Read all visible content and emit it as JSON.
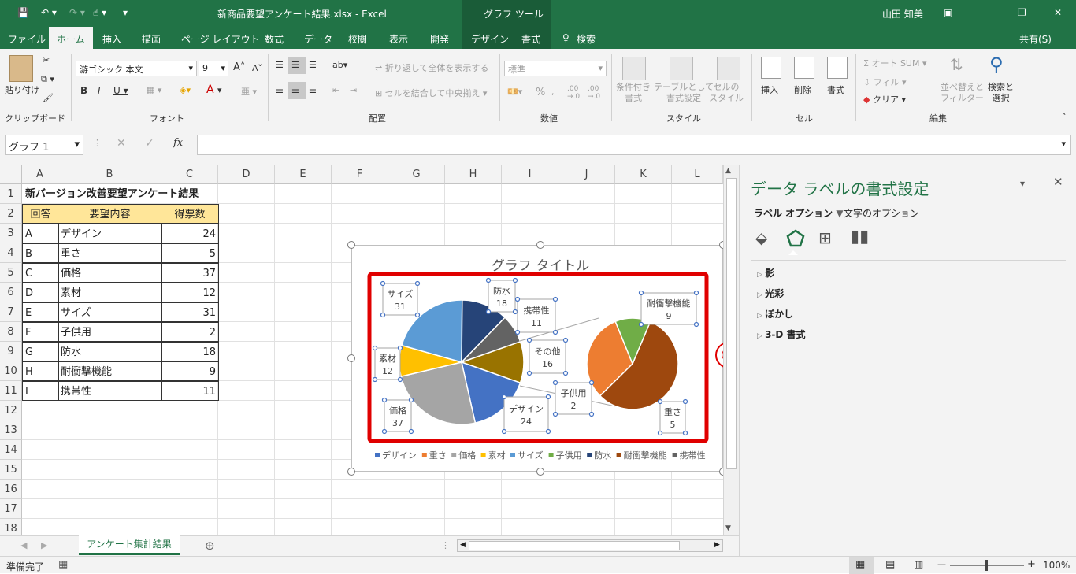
{
  "window": {
    "title": "新商品要望アンケート結果.xlsx  -  Excel",
    "context_tool": "グラフ ツール",
    "user": "山田 知美"
  },
  "tabs": [
    "ファイル",
    "ホーム",
    "挿入",
    "描画",
    "ページ レイアウト",
    "数式",
    "データ",
    "校閲",
    "表示",
    "開発",
    "デザイン",
    "書式"
  ],
  "search_label": "検索",
  "share_label": "共有(S)",
  "ribbon": {
    "clipboard": {
      "paste": "貼り付け",
      "label": "クリップボード"
    },
    "font": {
      "name": "游ゴシック 本文",
      "size": "9",
      "label": "フォント"
    },
    "alignment": {
      "wrap": "折り返して全体を表示する",
      "merge": "セルを結合して中央揃え",
      "label": "配置"
    },
    "number": {
      "format": "標準",
      "label": "数値"
    },
    "styles": {
      "conditional": "条件付き\n書式",
      "table": "テーブルとして\n書式設定",
      "cell": "セルの\nスタイル",
      "label": "スタイル"
    },
    "cells": {
      "insert": "挿入",
      "delete": "削除",
      "format": "書式",
      "label": "セル"
    },
    "editing": {
      "autosum": "オート SUM",
      "fill": "フィル",
      "clear": "クリア",
      "sort": "並べ替えと\nフィルター",
      "find": "検索と\n選択",
      "label": "編集"
    }
  },
  "formula_bar": {
    "name_box": "グラフ 1",
    "fx": "fx",
    "value": ""
  },
  "sheet": {
    "columns": [
      "A",
      "B",
      "C",
      "D",
      "E",
      "F",
      "G",
      "H",
      "I",
      "J",
      "K",
      "L"
    ],
    "rows": [
      "1",
      "2",
      "3",
      "4",
      "5",
      "6",
      "7",
      "8",
      "9",
      "10",
      "11",
      "12",
      "13",
      "14",
      "15",
      "16",
      "17",
      "18"
    ],
    "title": "新バージョン改善要望アンケート結果",
    "headers": [
      "回答",
      "要望内容",
      "得票数"
    ],
    "data": [
      [
        "A",
        "デザイン",
        "24"
      ],
      [
        "B",
        "重さ",
        "5"
      ],
      [
        "C",
        "価格",
        "37"
      ],
      [
        "D",
        "素材",
        "12"
      ],
      [
        "E",
        "サイズ",
        "31"
      ],
      [
        "F",
        "子供用",
        "2"
      ],
      [
        "G",
        "防水",
        "18"
      ],
      [
        "H",
        "耐衝撃機能",
        "9"
      ],
      [
        "I",
        "携帯性",
        "11"
      ]
    ],
    "tab_name": "アンケート集計結果"
  },
  "chart_data": {
    "type": "pie",
    "title": "グラフ タイトル",
    "categories": [
      "デザイン",
      "重さ",
      "価格",
      "素材",
      "サイズ",
      "子供用",
      "防水",
      "耐衝撃機能",
      "携帯性"
    ],
    "values": [
      24,
      5,
      37,
      12,
      31,
      2,
      18,
      9,
      11
    ],
    "labels": [
      {
        "name": "サイズ",
        "value": "31"
      },
      {
        "name": "防水",
        "value": "18"
      },
      {
        "name": "携帯性",
        "value": "11"
      },
      {
        "name": "その他",
        "value": "16"
      },
      {
        "name": "耐衝撃機能",
        "value": "9"
      },
      {
        "name": "素材",
        "value": "12"
      },
      {
        "name": "子供用",
        "value": "2"
      },
      {
        "name": "価格",
        "value": "37"
      },
      {
        "name": "デザイン",
        "value": "24"
      },
      {
        "name": "重さ",
        "value": "5"
      }
    ],
    "colors": {
      "デザイン": "#4472c4",
      "重さ": "#ed7d31",
      "価格": "#a5a5a5",
      "素材": "#ffc000",
      "サイズ": "#5b9bd5",
      "子供用": "#70ad47",
      "防水": "#264478",
      "耐衝撃機能": "#9e480e",
      "携帯性": "#636363",
      "その他": "#997300"
    },
    "legend": "bottom"
  },
  "step_marker": "⑩",
  "panel": {
    "title": "データ ラベルの書式設定",
    "tab_label_options": "ラベル オプション",
    "tab_text_options": "文字のオプション",
    "sections": [
      "影",
      "光彩",
      "ぼかし",
      "3-D 書式"
    ]
  },
  "status": {
    "ready": "準備完了",
    "zoom": "100%"
  },
  "colors": {
    "accent": "#217346",
    "highlight": "#e00000"
  }
}
